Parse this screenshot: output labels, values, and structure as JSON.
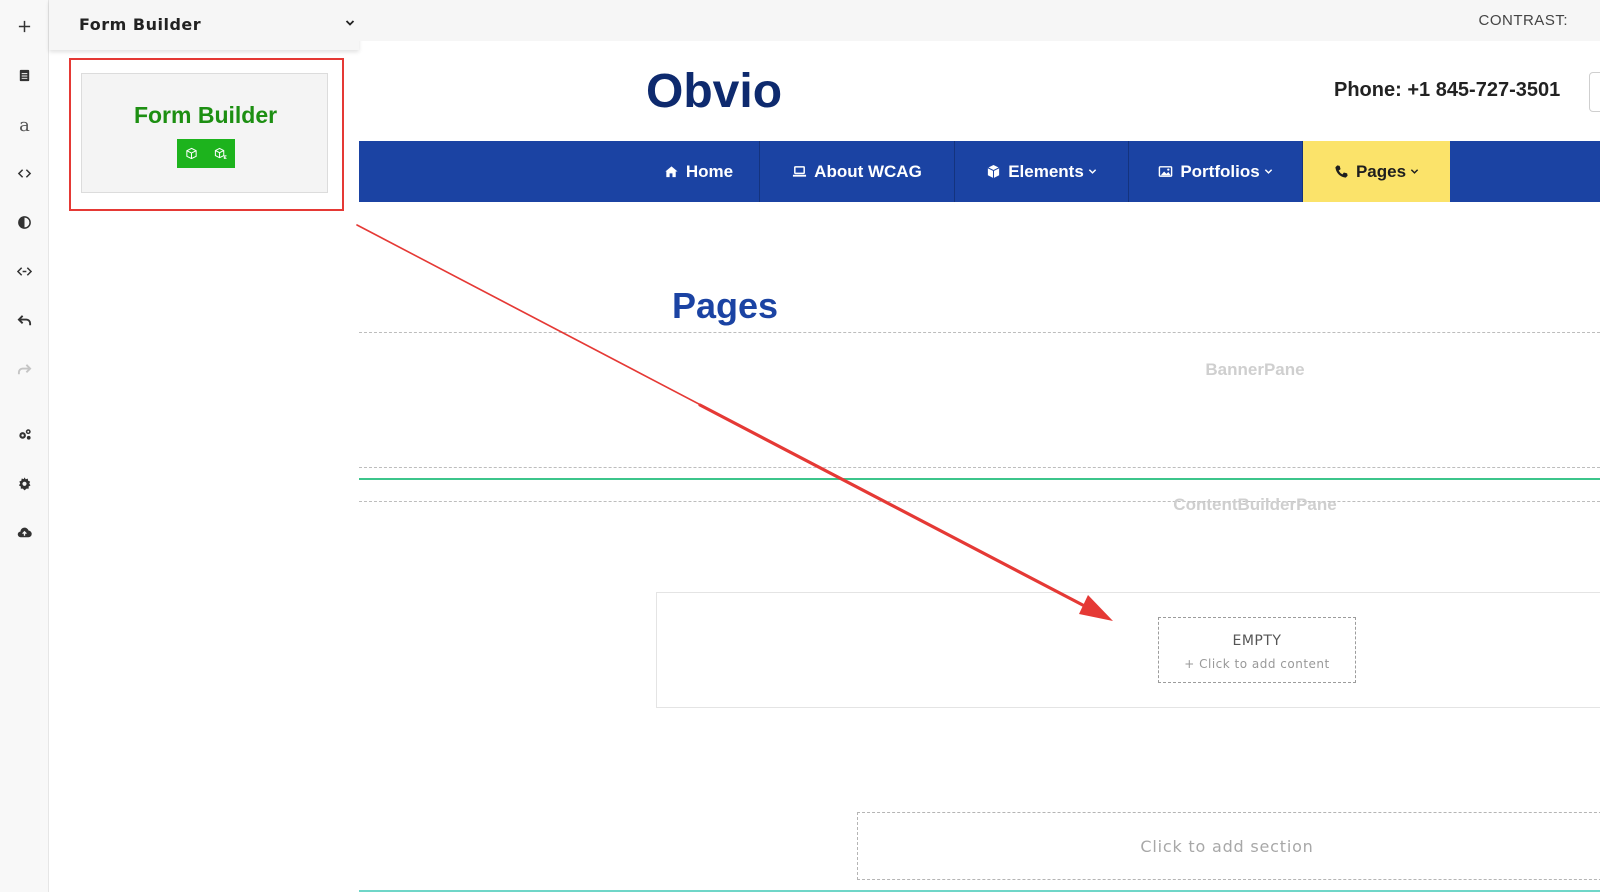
{
  "panel": {
    "title": "Form Builder",
    "snippet_title": "Form Builder",
    "snippet_icons": [
      "cube-icon",
      "cube-e-icon"
    ]
  },
  "toolbar": {
    "items": [
      "add-icon",
      "document-icon",
      "font-icon",
      "code-icon",
      "contrast-icon",
      "resize-icon",
      "undo-icon",
      "redo-icon",
      "settings-group-icon",
      "gear-icon",
      "cloud-upload-icon"
    ],
    "font_letter": "a"
  },
  "site": {
    "contrast_label": "CONTRAST:",
    "logo": "Obvio",
    "phone": "Phone: +1 845-727-3501",
    "nav": [
      {
        "label": "Home",
        "icon": "home-icon",
        "dropdown": false
      },
      {
        "label": "About WCAG",
        "icon": "laptop-icon",
        "dropdown": false
      },
      {
        "label": "Elements",
        "icon": "cube-icon",
        "dropdown": true
      },
      {
        "label": "Portfolios",
        "icon": "image-icon",
        "dropdown": true
      },
      {
        "label": "Pages",
        "icon": "phone-icon",
        "dropdown": true,
        "active": true
      }
    ],
    "page_heading": "Pages",
    "banner_pane": "BannerPane",
    "content_pane": "ContentBuilderPane",
    "empty_title": "EMPTY",
    "empty_sub": "+ Click to add content",
    "add_section": "Click to add section"
  },
  "colors": {
    "nav_bg": "#1b43a3",
    "nav_active": "#fbe36a",
    "logo": "#0e2a6e",
    "snippet_green": "#1d8f12",
    "icon_green": "#1db31d",
    "highlight_red": "#e53935",
    "pane_divider": "#3cc58b"
  }
}
